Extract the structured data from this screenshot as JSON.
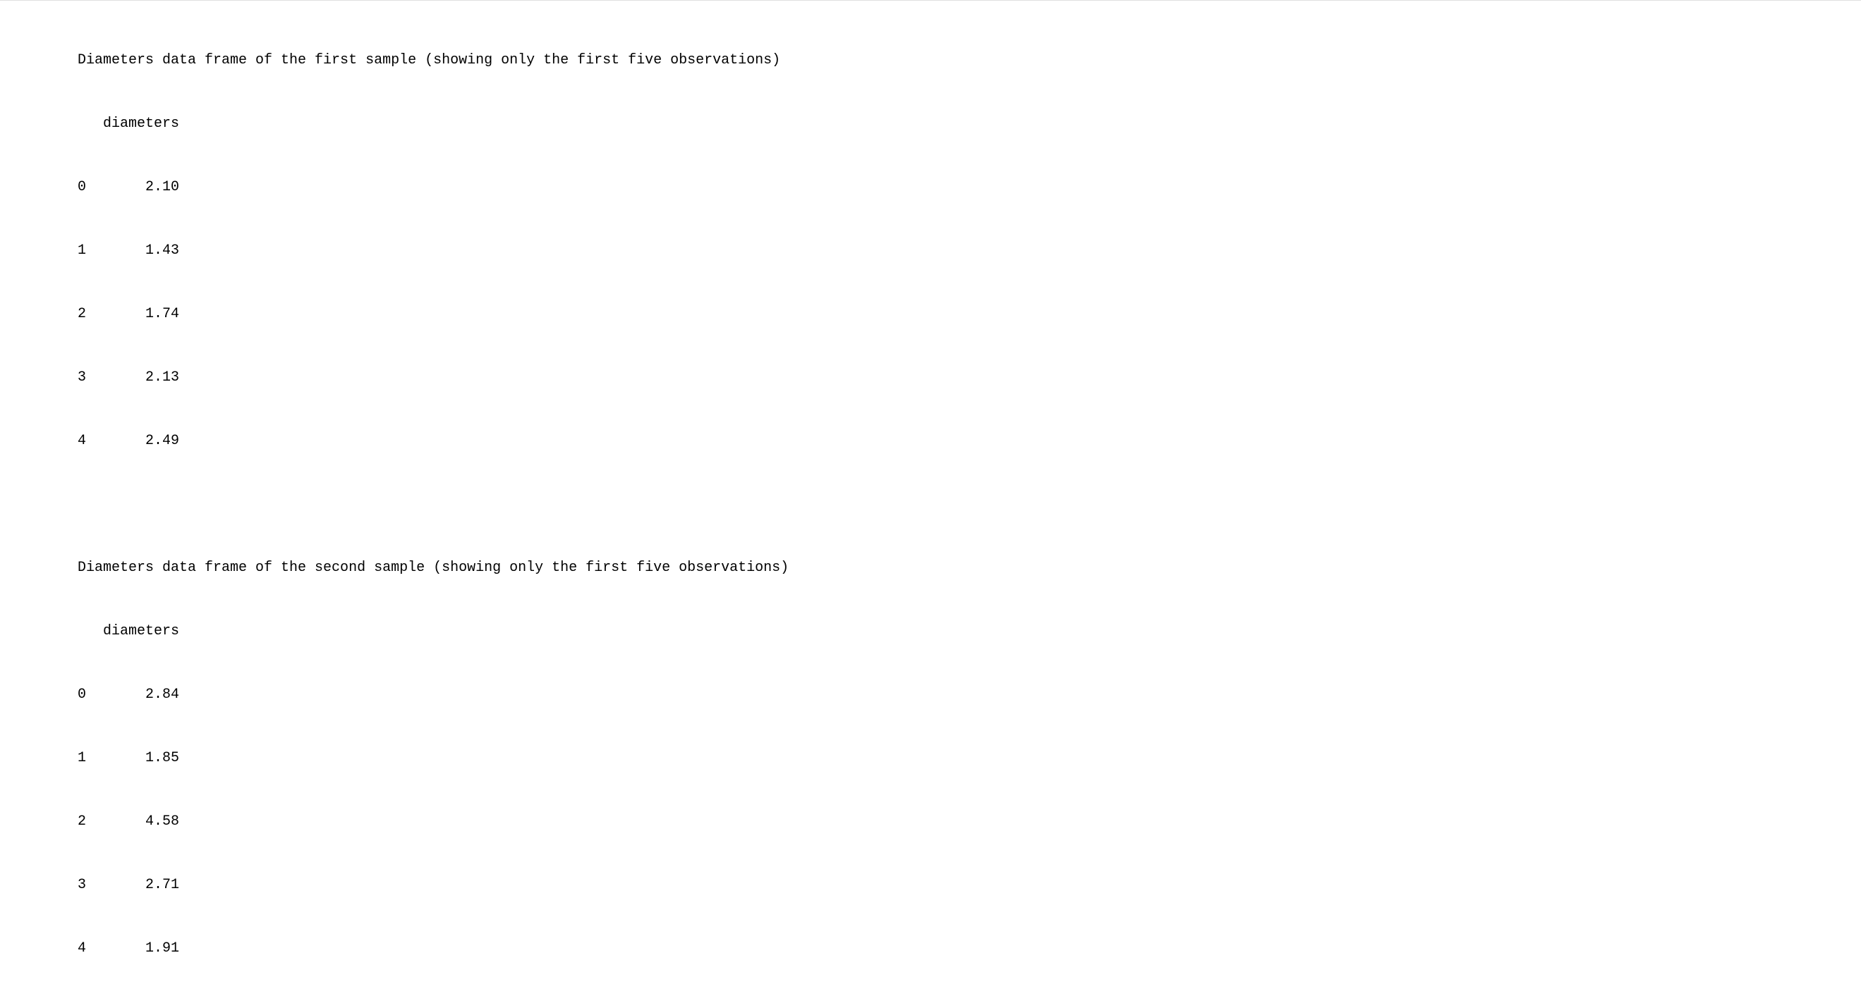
{
  "output": {
    "sample1": {
      "title": "Diameters data frame of the first sample (showing only the first five observations)",
      "header": "   diameters",
      "rows": [
        "0       2.10",
        "1       1.43",
        "2       1.74",
        "3       2.13",
        "4       2.49"
      ]
    },
    "sample2": {
      "title": "Diameters data frame of the second sample (showing only the first five observations)",
      "header": "   diameters",
      "rows": [
        "0       2.84",
        "1       1.85",
        "2       4.58",
        "3       2.71",
        "4       1.91"
      ]
    }
  }
}
